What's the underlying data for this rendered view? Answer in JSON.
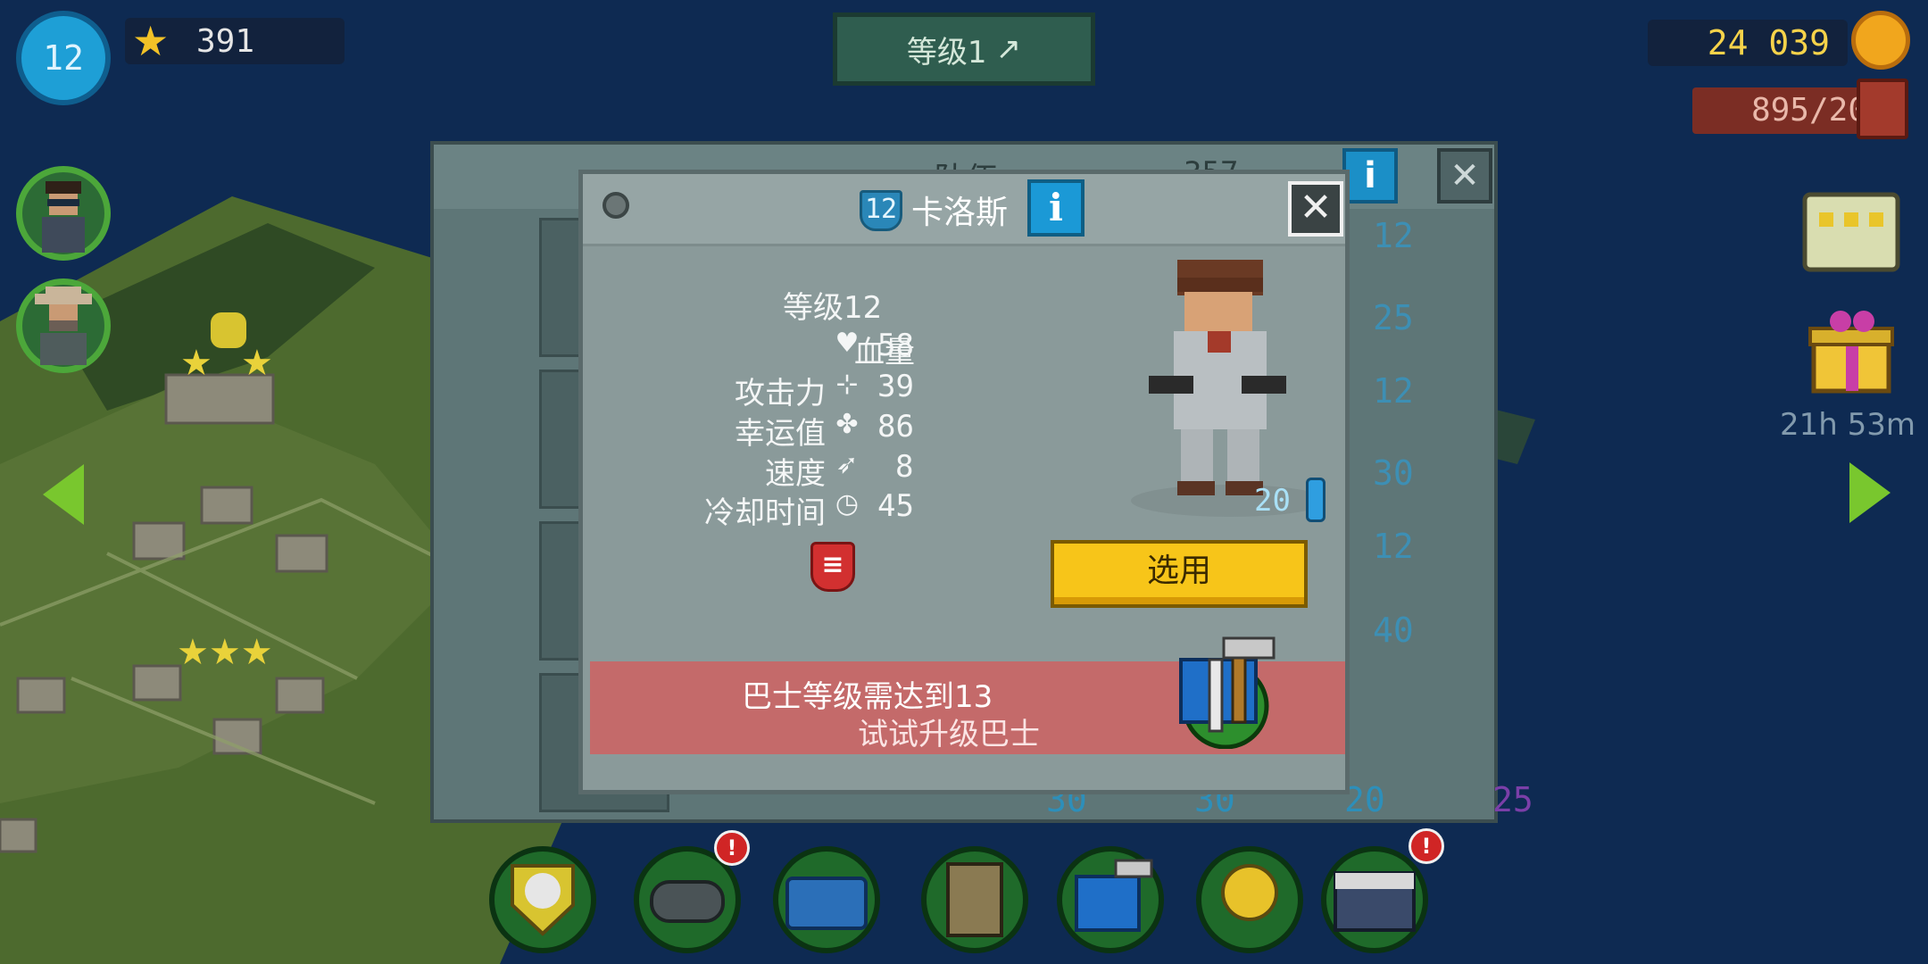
{
  "hud": {
    "player_level": "12",
    "stars": "391",
    "area_level": "等级1",
    "coins": "24 039",
    "fuel": "895/20",
    "timer": "21h 53m"
  },
  "team_window": {
    "title": "队伍",
    "count": "357",
    "info_label": "i",
    "close_label": "✕",
    "card_numbers": [
      "12",
      "25",
      "12",
      "30",
      "12",
      "40",
      "30",
      "30",
      "20",
      "25"
    ]
  },
  "character": {
    "level_badge": "12",
    "name": "卡洛斯",
    "info_label": "i",
    "close_label": "✕",
    "level_text": "等级12",
    "stats": [
      {
        "label": "血量",
        "icon": "heart-icon",
        "value": "58"
      },
      {
        "label": "攻击力",
        "icon": "attack-icon",
        "value": "39"
      },
      {
        "label": "幸运值",
        "icon": "clover-icon",
        "value": "86"
      },
      {
        "label": "速度",
        "icon": "boot-icon",
        "value": "8"
      },
      {
        "label": "冷却时间",
        "icon": "stopwatch-icon",
        "value": "45"
      }
    ],
    "equip_button": "选用",
    "cost": "20",
    "requirement_line1": "巴士等级需达到13",
    "requirement_line2": "试试升级巴士"
  },
  "dock": {
    "badges": [
      "!",
      "!",
      "!"
    ]
  },
  "colors": {
    "accent_yellow": "#f7c519",
    "requirement_red": "#c46a6a",
    "info_blue": "#1b99d6"
  }
}
